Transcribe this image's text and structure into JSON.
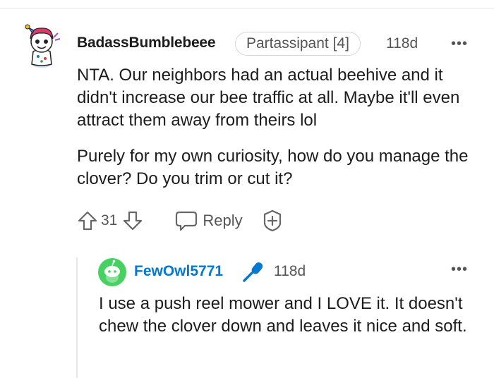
{
  "comment": {
    "username": "BadassBumblebeee",
    "flair": "Partassipant [4]",
    "age": "118d",
    "more": "•••",
    "paragraphs": [
      "NTA. Our neighbors had an actual beehive and it didn't increase our bee traffic at all. Maybe it'll even attract them away from theirs lol",
      "Purely for my own curiosity, how do you manage the clover? Do you trim or cut it?"
    ],
    "votes": "31",
    "reply_label": "Reply"
  },
  "reply": {
    "username": "FewOwl5771",
    "age": "118d",
    "more": "•••",
    "body": "I use a push reel mower and I LOVE it. It doesn't chew the clover down and leaves it nice and soft."
  },
  "colors": {
    "username_reply": "#0079d3",
    "mic_icon": "#0079d3",
    "avatar_reply_bg": "#46d160"
  },
  "icons": [
    "snoo-avatar",
    "upvote-icon",
    "downvote-icon",
    "reply-icon",
    "award-icon",
    "snoo-avatar-green",
    "microphone-icon",
    "more-options-icon"
  ]
}
